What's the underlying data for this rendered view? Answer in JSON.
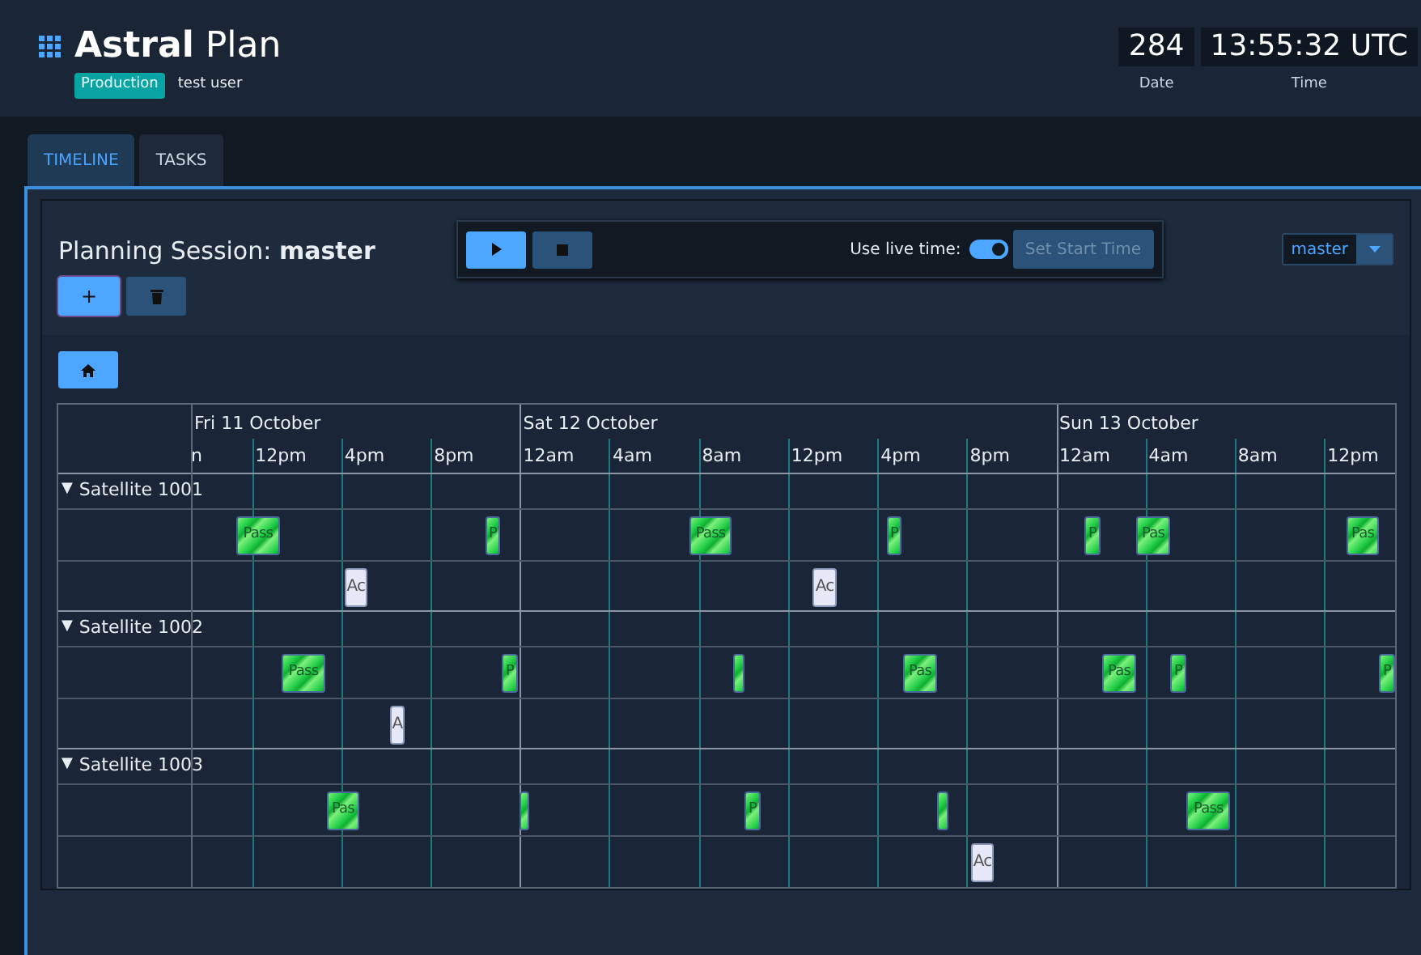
{
  "header": {
    "title_bold": "Astral",
    "title_rest": "Plan",
    "environment": "Production",
    "user": "test user",
    "counters": [
      {
        "value": "284",
        "caption": "Date"
      },
      {
        "value": "13:55:32 UTC",
        "caption": "Time"
      }
    ]
  },
  "tabs": [
    {
      "label": "TIMELINE",
      "selected": true
    },
    {
      "label": "TASKS",
      "selected": false
    }
  ],
  "session": {
    "label": "Planning Session:",
    "name": "master",
    "add_button": "+"
  },
  "playback": {
    "live_label": "Use live time:",
    "live_time": true,
    "set_start_button": "Set Start Time",
    "set_start_disabled": true
  },
  "session_select": {
    "value": "master"
  },
  "timeline": {
    "days": [
      "Fri 11 October",
      "Sat 12 October",
      "Sun 13 October"
    ],
    "ticks": [
      "n",
      "12pm",
      "4pm",
      "8pm",
      "12am",
      "4am",
      "8am",
      "12pm",
      "4pm",
      "8pm",
      "12am",
      "4am",
      "8am",
      "12pm"
    ],
    "groups": [
      {
        "name": "Satellite 1001",
        "toggle": "▼",
        "expanded": true,
        "lanes": [
          {
            "items": [
              {
                "kind": "pass",
                "label": "Pass"
              },
              {
                "kind": "pass",
                "label": "P"
              },
              {
                "kind": "pass",
                "label": "Pass"
              },
              {
                "kind": "pass",
                "label": "P"
              },
              {
                "kind": "pass",
                "label": "P"
              },
              {
                "kind": "pass",
                "label": "Pas"
              },
              {
                "kind": "pass",
                "label": "Pas"
              }
            ]
          },
          {
            "items": [
              {
                "kind": "activity",
                "label": "Ac"
              },
              {
                "kind": "activity",
                "label": "Ac"
              }
            ]
          }
        ]
      },
      {
        "name": "Satellite 1002",
        "toggle": "▼",
        "expanded": true,
        "lanes": [
          {
            "items": [
              {
                "kind": "pass",
                "label": "Pass"
              },
              {
                "kind": "pass",
                "label": "P"
              },
              {
                "kind": "pass"
              },
              {
                "kind": "pass",
                "label": "Pas"
              },
              {
                "kind": "pass",
                "label": "Pas"
              },
              {
                "kind": "pass",
                "label": "P"
              },
              {
                "kind": "pass",
                "label": "P"
              }
            ]
          },
          {
            "items": [
              {
                "kind": "activity",
                "label": "A"
              }
            ]
          }
        ]
      },
      {
        "name": "Satellite 1003",
        "toggle": "▼",
        "expanded": true,
        "lanes": [
          {
            "items": [
              {
                "kind": "pass",
                "label": "Pas"
              },
              {
                "kind": "pass"
              },
              {
                "kind": "pass",
                "label": "P"
              },
              {
                "kind": "pass"
              },
              {
                "kind": "pass",
                "label": "Pass"
              }
            ]
          },
          {
            "items": [
              {
                "kind": "activity",
                "label": "Ac"
              }
            ]
          }
        ]
      }
    ]
  }
}
